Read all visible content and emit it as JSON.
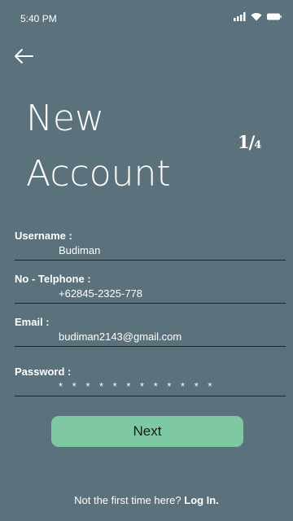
{
  "status_bar": {
    "time": "5:40 PM",
    "icons": [
      "signal-icon",
      "wifi-icon",
      "battery-icon"
    ]
  },
  "header": {
    "back_icon": "arrow-left-icon",
    "title_line1": "New",
    "title_line2": "Account",
    "step_current": "1",
    "step_total": "4"
  },
  "form": {
    "username": {
      "label": "Username  :",
      "value": "Budiman"
    },
    "phone": {
      "label": "No - Telphone :",
      "value": "+62845-2325-778"
    },
    "email": {
      "label": "Email :",
      "value": "budiman2143@gmail.com"
    },
    "password": {
      "label": "Password :",
      "value": "* * * * * * * * * * * *"
    }
  },
  "actions": {
    "next_label": "Next"
  },
  "footer": {
    "prompt": "Not the first time here?",
    "login_label": "Log In."
  },
  "colors": {
    "background": "#5b717b",
    "accent": "#7ec9a3",
    "underline": "#1b2429"
  }
}
